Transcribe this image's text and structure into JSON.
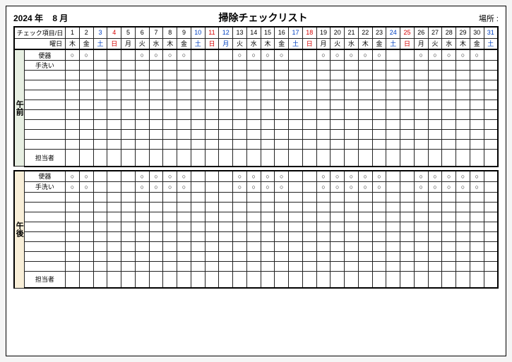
{
  "header": {
    "year": "2024 年",
    "month": "8 月",
    "title": "掃除チェックリスト",
    "place_label": "場所 :"
  },
  "row_labels": {
    "check_item_day": "チェック項目/日",
    "weekday": "曜日",
    "benki": "便器",
    "tearai": "手洗い",
    "tantou": "担当者"
  },
  "side_labels": {
    "am": "午前",
    "pm": "午後"
  },
  "days": [
    "1",
    "2",
    "3",
    "4",
    "5",
    "6",
    "7",
    "8",
    "9",
    "10",
    "11",
    "12",
    "13",
    "14",
    "15",
    "16",
    "17",
    "18",
    "19",
    "20",
    "21",
    "22",
    "23",
    "24",
    "25",
    "26",
    "27",
    "28",
    "29",
    "30",
    "31"
  ],
  "day_color": [
    "",
    "",
    "blue",
    "red",
    "",
    "",
    "",
    "",
    "",
    "blue",
    "red",
    "blue",
    "",
    "",
    "",
    "",
    "blue",
    "red",
    "",
    "",
    "",
    "",
    "",
    "blue",
    "red",
    "",
    "",
    "",
    "",
    "",
    "blue"
  ],
  "weekdays": [
    "木",
    "金",
    "土",
    "日",
    "月",
    "火",
    "水",
    "木",
    "金",
    "土",
    "日",
    "月",
    "火",
    "水",
    "木",
    "金",
    "土",
    "日",
    "月",
    "火",
    "水",
    "木",
    "金",
    "土",
    "日",
    "月",
    "火",
    "水",
    "木",
    "金",
    "土"
  ],
  "mark": "○",
  "am": {
    "benki": [
      1,
      1,
      0,
      0,
      0,
      1,
      1,
      1,
      1,
      0,
      0,
      0,
      1,
      1,
      1,
      1,
      0,
      0,
      1,
      1,
      1,
      1,
      1,
      0,
      0,
      1,
      1,
      1,
      1,
      1,
      0
    ],
    "tearai": [
      0,
      0,
      0,
      0,
      0,
      0,
      0,
      0,
      0,
      0,
      0,
      0,
      0,
      0,
      0,
      0,
      0,
      0,
      0,
      0,
      0,
      0,
      0,
      0,
      0,
      0,
      0,
      0,
      0,
      0,
      0
    ]
  },
  "pm": {
    "benki": [
      1,
      1,
      0,
      0,
      0,
      1,
      1,
      1,
      1,
      0,
      0,
      0,
      1,
      1,
      1,
      1,
      0,
      0,
      1,
      1,
      1,
      1,
      1,
      0,
      0,
      1,
      1,
      1,
      1,
      1,
      0
    ],
    "tearai": [
      1,
      1,
      0,
      0,
      0,
      1,
      1,
      1,
      1,
      0,
      0,
      0,
      1,
      1,
      1,
      1,
      0,
      0,
      1,
      1,
      1,
      1,
      1,
      0,
      0,
      1,
      1,
      1,
      1,
      1,
      0
    ]
  }
}
